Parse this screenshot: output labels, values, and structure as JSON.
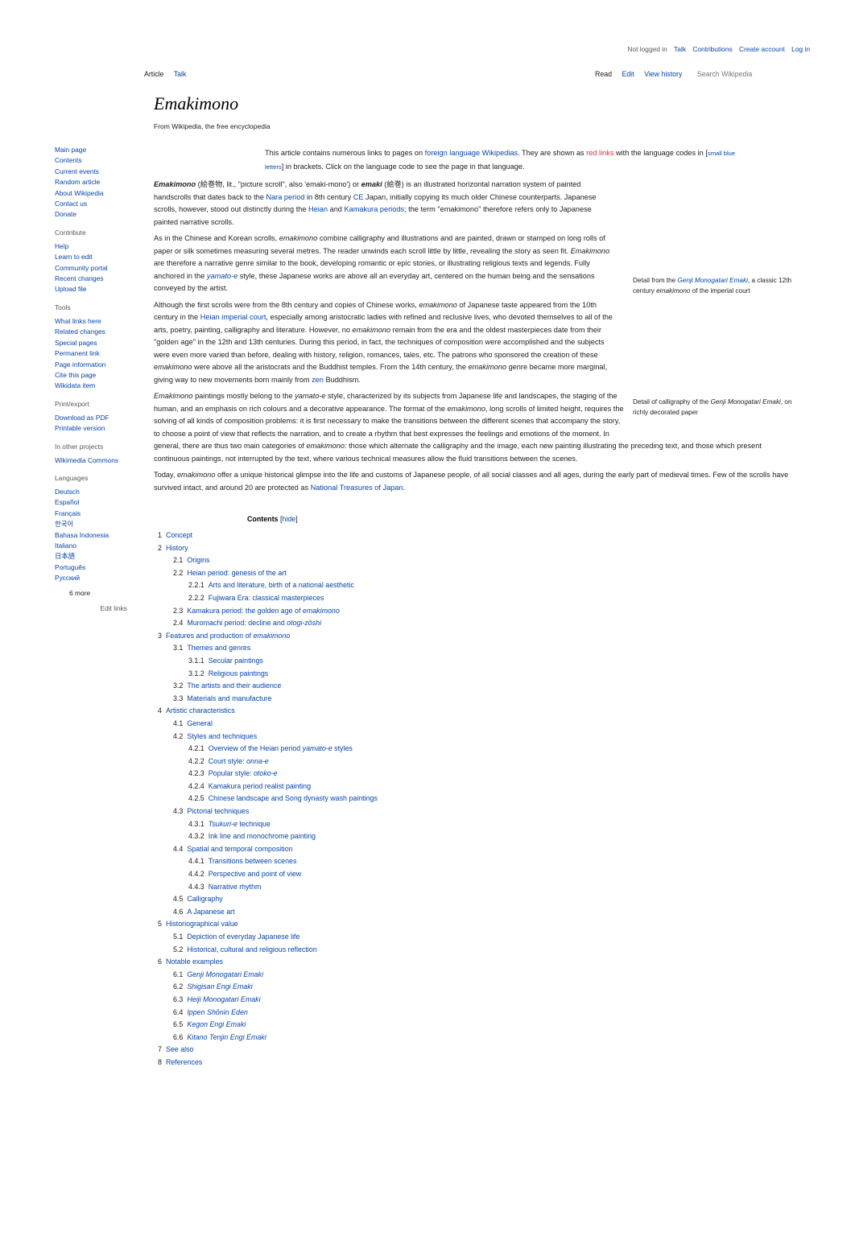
{
  "personal_tools": {
    "not_logged_in": "Not logged in",
    "talk": "Talk",
    "contributions": "Contributions",
    "create_account": "Create account",
    "log_in": "Log in"
  },
  "namespaces": {
    "article": "Article",
    "talk": "Talk"
  },
  "views": {
    "read": "Read",
    "edit": "Edit",
    "view_history": "View history"
  },
  "search": {
    "placeholder": "Search Wikipedia"
  },
  "page": {
    "title": "Emakimono",
    "subtitle": "From Wikipedia, the free encyclopedia"
  },
  "sidebar": {
    "navigation": [
      "Main page",
      "Contents",
      "Current events",
      "Random article",
      "About Wikipedia",
      "Contact us",
      "Donate"
    ],
    "contribute": {
      "heading": "Contribute",
      "items": [
        "Help",
        "Learn to edit",
        "Community portal",
        "Recent changes",
        "Upload file"
      ]
    },
    "tools": {
      "heading": "Tools",
      "items": [
        "What links here",
        "Related changes",
        "Special pages",
        "Permanent link",
        "Page information",
        "Cite this page",
        "Wikidata item"
      ]
    },
    "print": {
      "heading": "Print/export",
      "items": [
        "Download as PDF",
        "Printable version"
      ]
    },
    "other_projects": {
      "heading": "In other projects",
      "items": [
        "Wikimedia Commons"
      ]
    },
    "languages": {
      "heading": "Languages",
      "items": [
        "Deutsch",
        "Español",
        "Français",
        "한국어",
        "Bahasa Indonesia",
        "Italiano",
        "日本語",
        "Português",
        "Русский"
      ],
      "more": "6 more",
      "edit_links": "Edit links"
    }
  },
  "notice": {
    "t1": "This article contains numerous links to pages on ",
    "link1": "foreign language Wikipedias",
    "t2": ". They are shown as ",
    "red": "red links",
    "t3": " with the language codes in [",
    "small": "small blue letters",
    "t4": "] in brackets. Click on the language code to see the page in that language."
  },
  "intro": {
    "p1": {
      "b1": "Emakimono",
      "t1": " (絵巻物, lit., \"picture scroll\", also 'emaki-mono') or ",
      "b2": "emaki",
      "t2": " (絵巻) is an illustrated horizontal narration system of painted handscrolls that dates back to the ",
      "l1": "Nara period",
      "t3": " in 8th century ",
      "l2": "CE",
      "t4": " Japan, initially copying its much older Chinese counterparts. Japanese scrolls, however, stood out distinctly during the ",
      "l3": "Heian",
      "t5": " and ",
      "l4": "Kamakura periods",
      "t6": "; the term \"emakimono\" therefore refers only to Japanese painted narrative scrolls."
    },
    "p2": {
      "t1": "As in the Chinese and Korean scrolls, ",
      "i1": "emakimono",
      "t2": " combine calligraphy and illustrations and are painted, drawn or stamped on long rolls of paper or silk sometimes measuring several metres. The reader unwinds each scroll little by little, revealing the story as seen fit. ",
      "i2": "Emakimono",
      "t3": " are therefore a narrative genre similar to the book, developing romantic or epic stories, or illustrating religious texts and legends. Fully anchored in the ",
      "l1": "yamato-e",
      "t4": " style, these Japanese works are above all an everyday art, centered on the human being and the sensations conveyed by the artist."
    },
    "p3": {
      "t1": "Although the first scrolls were from the 8th century and copies of Chinese works, ",
      "i1": "emakimono",
      "t2": " of Japanese taste appeared from the 10th century in the ",
      "l1": "Heian imperial court",
      "t3": ", especially among aristocratic ladies with refined and reclusive lives, who devoted themselves to all of the arts, poetry, painting, calligraphy and literature. However, no ",
      "i2": "emakimono",
      "t4": " remain from the era and the oldest masterpieces date from their \"golden age\" in the 12th and 13th centuries. During this period, in fact, the techniques of composition were accomplished and the subjects were even more varied than before, dealing with history, religion, romances, tales, etc. The patrons who sponsored the creation of these ",
      "i3": "emakimono",
      "t5": " were above all the aristocrats and the Buddhist temples. From the 14th century, the ",
      "i4": "emakimono",
      "t6": " genre became more marginal, giving way to new movements born mainly from ",
      "l2": "zen",
      "t7": " Buddhism."
    },
    "p4": {
      "i1": "Emakimono",
      "t1": " paintings mostly belong to the ",
      "i2": "yamato-e",
      "t2": " style, characterized by its subjects from Japanese life and landscapes, the staging of the human, and an emphasis on rich colours and a decorative appearance. The format of the ",
      "i3": "emakimono",
      "t3": ", long scrolls of limited height, requires the solving of all kinds of composition problems: it is first necessary to make the transitions between the different scenes that accompany the story, to choose a point of view that reflects the narration, and to create a rhythm that best expresses the feelings and emotions of the moment. In general, there are thus two main categories of ",
      "i4": "emakimono",
      "t4": ": those which alternate the calligraphy and the image, each new painting illustrating the preceding text, and those which present continuous paintings, not interrupted by the text, where various technical measures allow the fluid transitions between the scenes."
    },
    "p5": {
      "t1": "Today, ",
      "i1": "emakimono",
      "t2": " offer a unique historical glimpse into the life and customs of Japanese people, of all social classes and all ages, during the early part of medieval times. Few of the scrolls have survived intact, and around 20 are protected as ",
      "l1": "National Treasures of Japan",
      "t3": "."
    }
  },
  "captions": {
    "c1": {
      "t1": "Detail from the ",
      "l1": "Genji Monogatari Emaki",
      "t2": ", a classic 12th century ",
      "i1": "emakimono",
      "t3": " of the imperial court"
    },
    "c2": {
      "t1": "Detail of calligraphy of the ",
      "i1": "Genji Monogatari Emaki",
      "t2": ", on richly decorated paper"
    }
  },
  "toc": {
    "title": "Contents",
    "toggle": "hide",
    "items": [
      {
        "num": "1",
        "level": 1,
        "text": "Concept"
      },
      {
        "num": "2",
        "level": 1,
        "text": "History"
      },
      {
        "num": "2.1",
        "level": 2,
        "text": "Origins"
      },
      {
        "num": "2.2",
        "level": 2,
        "text": "Heian period: genesis of the art"
      },
      {
        "num": "2.2.1",
        "level": 3,
        "text": "Arts and literature, birth of a national aesthetic"
      },
      {
        "num": "2.2.2",
        "level": 3,
        "text": "Fujiwara Era: classical masterpieces"
      },
      {
        "num": "2.3",
        "level": 2,
        "text": "Kamakura period: the golden age of ",
        "italic": "emakimono"
      },
      {
        "num": "2.4",
        "level": 2,
        "text": "Muromachi period: decline and ",
        "italic": "otogi-zōshi"
      },
      {
        "num": "3",
        "level": 1,
        "text": "Features and production of ",
        "italic": "emakimono"
      },
      {
        "num": "3.1",
        "level": 2,
        "text": "Themes and genres"
      },
      {
        "num": "3.1.1",
        "level": 3,
        "text": "Secular paintings"
      },
      {
        "num": "3.1.2",
        "level": 3,
        "text": "Religious paintings"
      },
      {
        "num": "3.2",
        "level": 2,
        "text": "The artists and their audience"
      },
      {
        "num": "3.3",
        "level": 2,
        "text": "Materials and manufacture"
      },
      {
        "num": "4",
        "level": 1,
        "text": "Artistic characteristics"
      },
      {
        "num": "4.1",
        "level": 2,
        "text": "General"
      },
      {
        "num": "4.2",
        "level": 2,
        "text": "Styles and techniques"
      },
      {
        "num": "4.2.1",
        "level": 3,
        "text": "Overview of the Heian period ",
        "italic": "yamato-e",
        "after": " styles"
      },
      {
        "num": "4.2.2",
        "level": 3,
        "text": "Court style: ",
        "italic": "onna-e"
      },
      {
        "num": "4.2.3",
        "level": 3,
        "text": "Popular style: ",
        "italic": "otoko-e"
      },
      {
        "num": "4.2.4",
        "level": 3,
        "text": "Kamakura period realist painting"
      },
      {
        "num": "4.2.5",
        "level": 3,
        "text": "Chinese landscape and Song dynasty wash paintings"
      },
      {
        "num": "4.3",
        "level": 2,
        "text": "Pictorial techniques"
      },
      {
        "num": "4.3.1",
        "level": 3,
        "text": "",
        "italic": "Tsukuri-e",
        "after": " technique"
      },
      {
        "num": "4.3.2",
        "level": 3,
        "text": "Ink line and monochrome painting"
      },
      {
        "num": "4.4",
        "level": 2,
        "text": "Spatial and temporal composition"
      },
      {
        "num": "4.4.1",
        "level": 3,
        "text": "Transitions between scenes"
      },
      {
        "num": "4.4.2",
        "level": 3,
        "text": "Perspective and point of view"
      },
      {
        "num": "4.4.3",
        "level": 3,
        "text": "Narrative rhythm"
      },
      {
        "num": "4.5",
        "level": 2,
        "text": "Calligraphy"
      },
      {
        "num": "4.6",
        "level": 2,
        "text": "A Japanese art"
      },
      {
        "num": "5",
        "level": 1,
        "text": "Historiographical value"
      },
      {
        "num": "5.1",
        "level": 2,
        "text": "Depiction of everyday Japanese life"
      },
      {
        "num": "5.2",
        "level": 2,
        "text": "Historical, cultural and religious reflection"
      },
      {
        "num": "6",
        "level": 1,
        "text": "Notable examples"
      },
      {
        "num": "6.1",
        "level": 2,
        "text": "",
        "italic": "Genji Monogatari Emaki"
      },
      {
        "num": "6.2",
        "level": 2,
        "text": "",
        "italic": "Shigisan Engi Emaki"
      },
      {
        "num": "6.3",
        "level": 2,
        "text": "",
        "italic": "Heiji Monogatari Emaki"
      },
      {
        "num": "6.4",
        "level": 2,
        "text": "",
        "italic": "Ippen Shōnin Eden"
      },
      {
        "num": "6.5",
        "level": 2,
        "text": "",
        "italic": "Kegon Engi Emaki"
      },
      {
        "num": "6.6",
        "level": 2,
        "text": "",
        "italic": "Kitano Tenjin Engi Emaki"
      },
      {
        "num": "7",
        "level": 1,
        "text": "See also"
      },
      {
        "num": "8",
        "level": 1,
        "text": "References"
      }
    ]
  },
  "colors": {
    "link": "#0645ad",
    "red_link": "#dd3333",
    "text": "#202122",
    "muted": "#54595d"
  }
}
